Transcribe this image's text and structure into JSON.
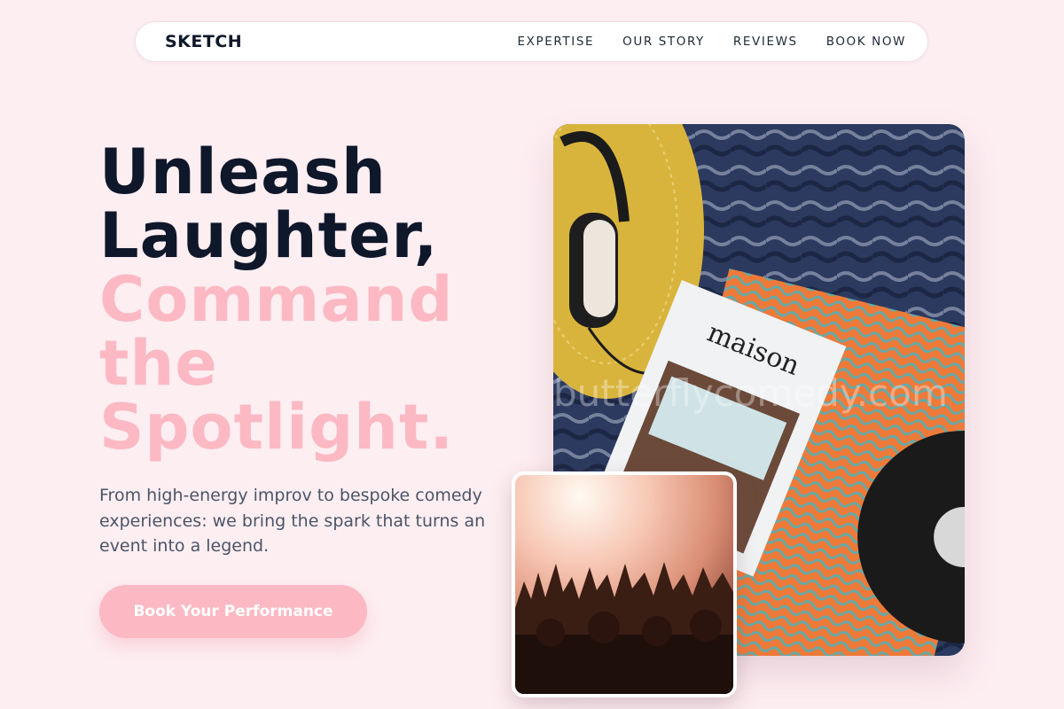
{
  "brand": {
    "logo": "SKETCH"
  },
  "nav": {
    "links": [
      "EXPERTISE",
      "OUR STORY",
      "REVIEWS",
      "BOOK NOW"
    ]
  },
  "hero": {
    "headline_dark_1": "Unleash",
    "headline_dark_2": "Laughter,",
    "headline_pink_1": "Command",
    "headline_pink_2": "the",
    "headline_pink_3": "Spotlight.",
    "lede": "From high-energy improv to bespoke comedy experiences: we bring the spark that turns an event into a legend.",
    "cta_label": "Book Your Performance"
  },
  "images": {
    "main": {
      "icon": "photo-headphones-magazine-record",
      "magazine_title": "maison",
      "watermark": "butterflycomedy.com"
    },
    "small": {
      "icon": "photo-concert-crowd"
    }
  },
  "colors": {
    "background": "#fdeef2",
    "headline_dark": "#0f172a",
    "accent_pink": "#fcb9c3",
    "body_text": "#4b5566"
  }
}
